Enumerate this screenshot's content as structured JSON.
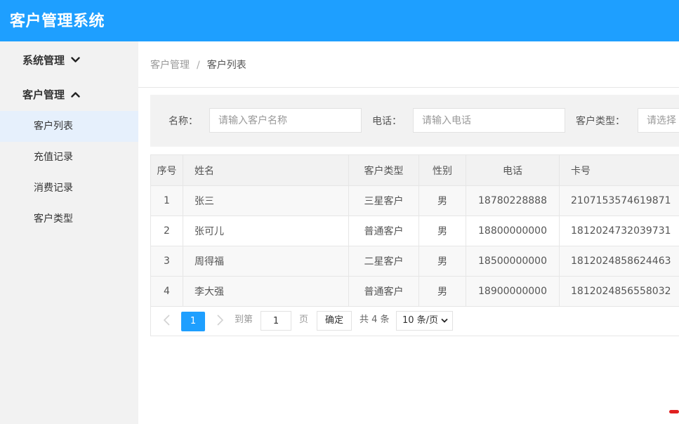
{
  "header": {
    "title": "客户管理系统"
  },
  "sidebar": {
    "groups": [
      {
        "label": "系统管理",
        "icon": "chevron-down-icon"
      },
      {
        "label": "客户管理",
        "icon": "chevron-up-icon"
      }
    ],
    "items": [
      {
        "label": "客户列表",
        "active": true
      },
      {
        "label": "充值记录"
      },
      {
        "label": "消费记录"
      },
      {
        "label": "客户类型"
      }
    ]
  },
  "breadcrumb": {
    "parent": "客户管理",
    "separator": "/",
    "current": "客户列表"
  },
  "search": {
    "name_label": "名称：",
    "name_placeholder": "请输入客户名称",
    "phone_label": "电话：",
    "phone_placeholder": "请输入电话",
    "type_label": "客户类型：",
    "type_placeholder": "请选择"
  },
  "table": {
    "headers": [
      "序号",
      "姓名",
      "客户类型",
      "性别",
      "电话",
      "卡号"
    ],
    "rows": [
      [
        "1",
        "张三",
        "三星客户",
        "男",
        "18780228888",
        "2107153574619871"
      ],
      [
        "2",
        "张可儿",
        "普通客户",
        "男",
        "18800000000",
        "1812024732039731"
      ],
      [
        "3",
        "周得福",
        "二星客户",
        "男",
        "18500000000",
        "1812024858624463"
      ],
      [
        "4",
        "李大强",
        "普通客户",
        "男",
        "18900000000",
        "1812024856558032"
      ]
    ]
  },
  "pagination": {
    "current_page": "1",
    "goto_label": "到第",
    "goto_value": "1",
    "page_unit": "页",
    "confirm_label": "确定",
    "total_label": "共 4 条",
    "page_size_label": "10 条/页"
  },
  "colors": {
    "header": "#1e9fff",
    "active_page": "#1e9fff",
    "sidebar_bg": "#f2f2f2"
  }
}
